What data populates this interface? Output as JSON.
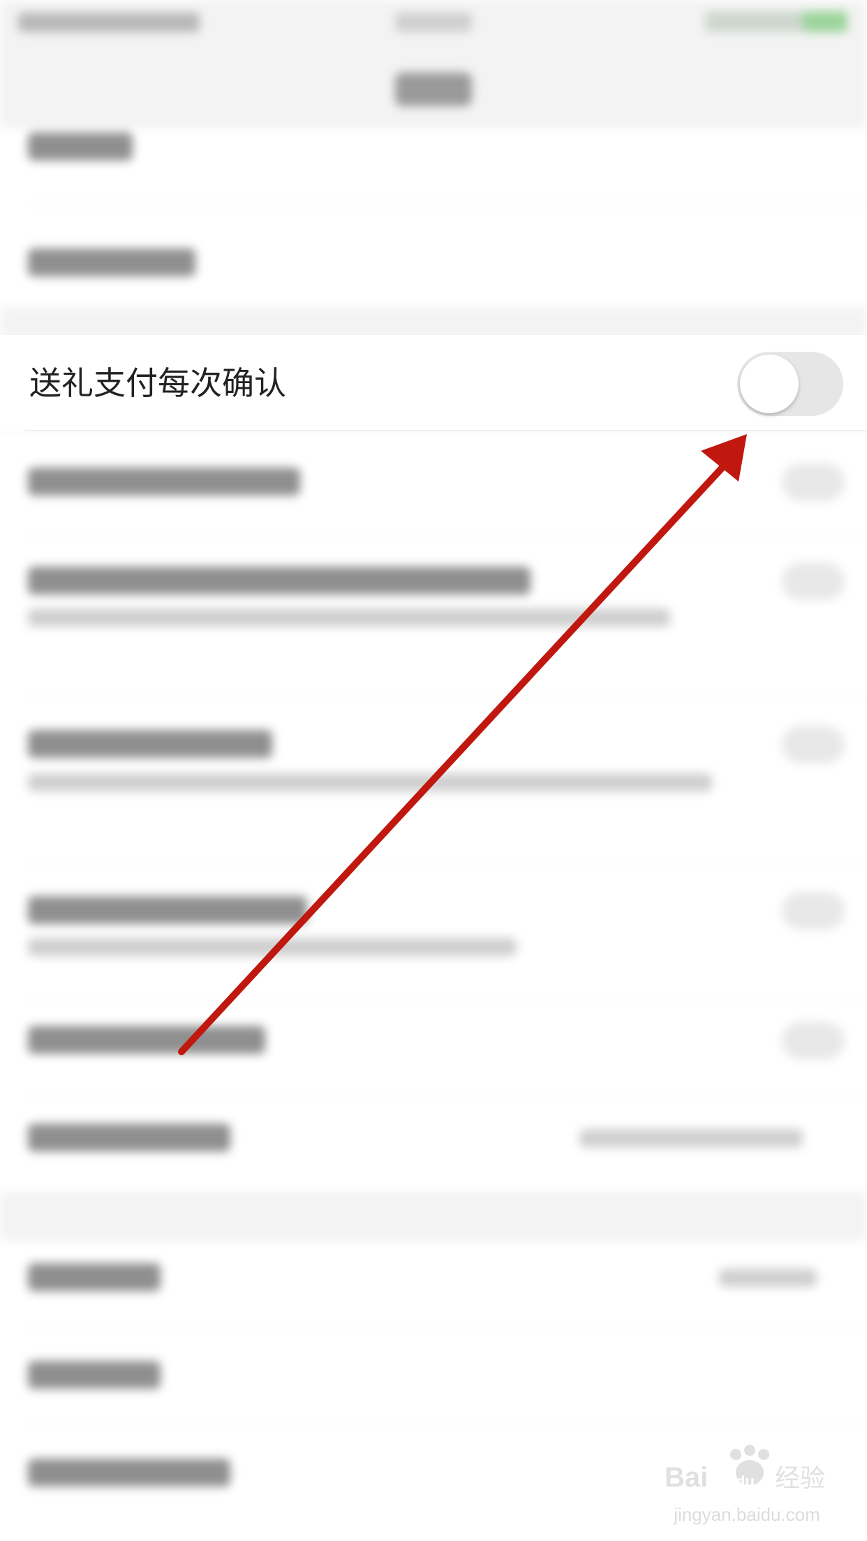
{
  "settings_row": {
    "label": "送礼支付每次确认",
    "toggle_state": "off"
  },
  "annotation": {
    "type": "arrow",
    "color": "#c0170f"
  },
  "watermark": {
    "logo": "Bai du 经验",
    "url": "jingyan.baidu.com"
  }
}
